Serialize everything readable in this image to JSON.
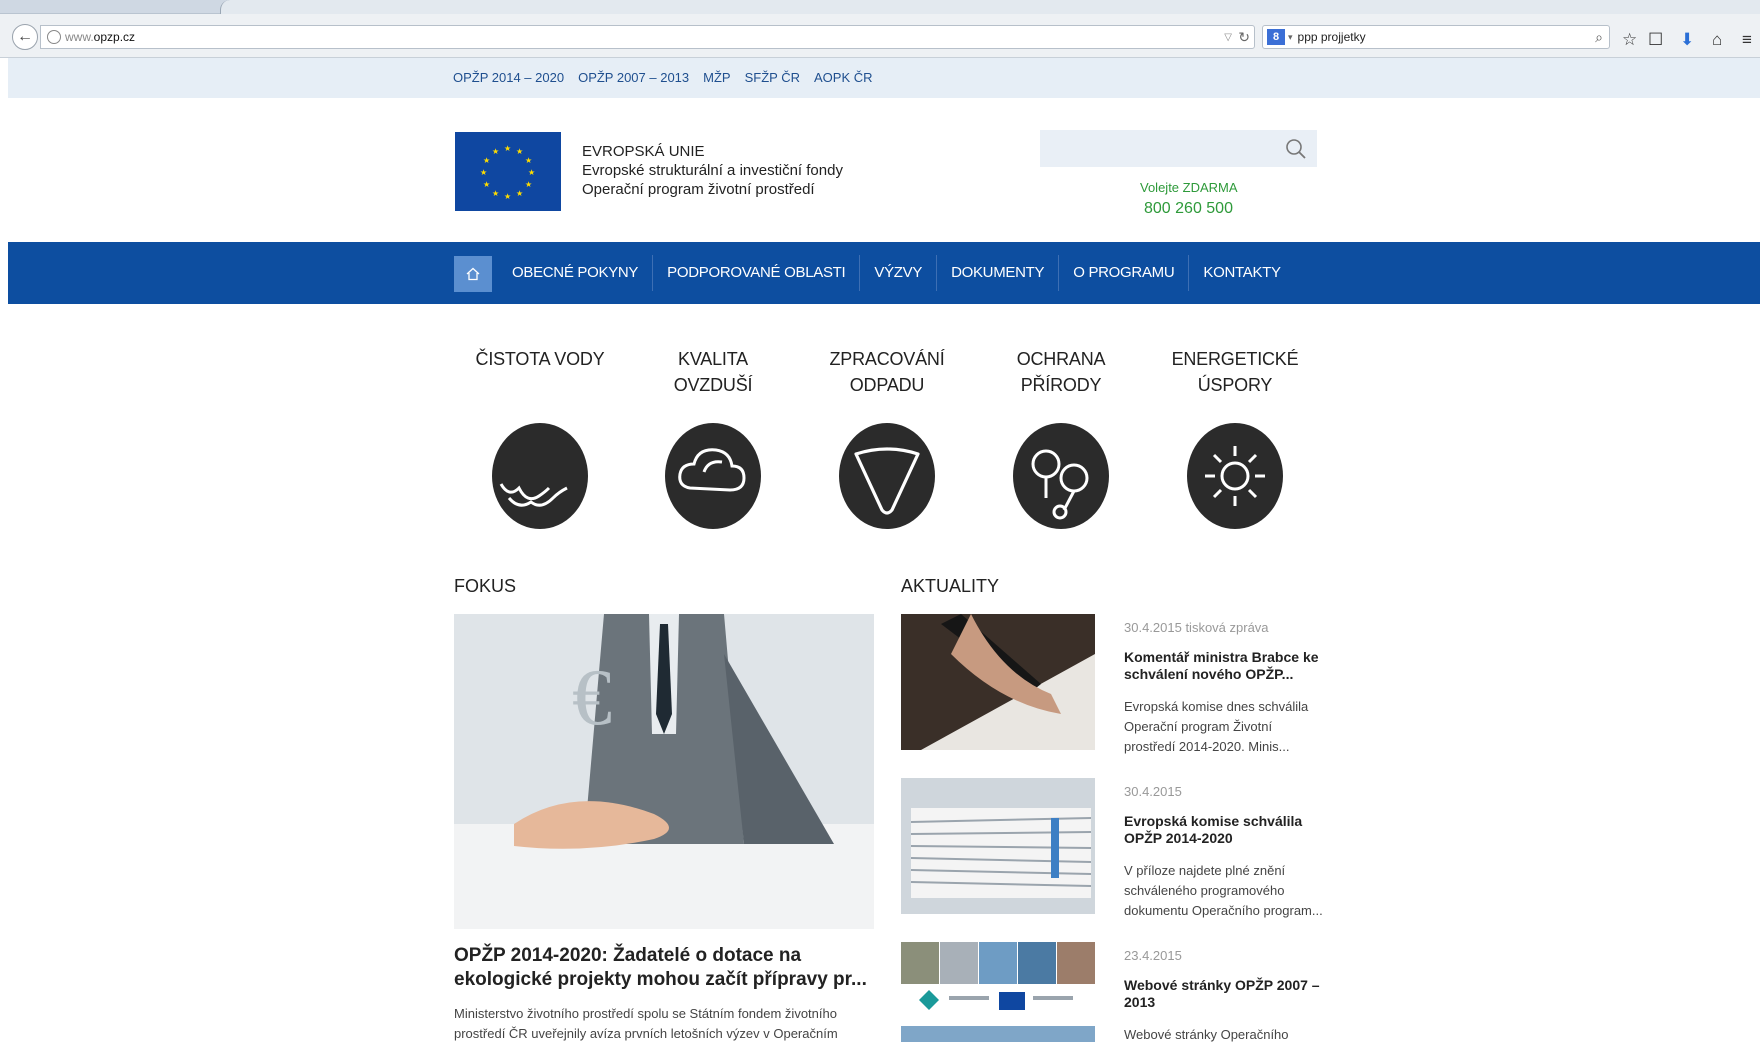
{
  "browser": {
    "url_prefix": "www.",
    "url_host": "opzp.cz",
    "search_query": "ppp projjetky"
  },
  "toplinks": [
    "OPŽP 2014 – 2020",
    "OPŽP 2007 – 2013",
    "MŽP",
    "SFŽP ČR",
    "AOPK ČR"
  ],
  "header": {
    "eu_line1": "EVROPSKÁ UNIE",
    "eu_line2": "Evropské strukturální a investiční fondy",
    "eu_line3": "Operační program životní prostředí",
    "search_placeholder": "",
    "hotline_label": "Volejte ZDARMA",
    "hotline_number": "800 260 500"
  },
  "nav": [
    "OBECNÉ POKYNY",
    "PODPOROVANÉ OBLASTI",
    "VÝZVY",
    "DOKUMENTY",
    "O PROGRAMU",
    "KONTAKTY"
  ],
  "categories": [
    {
      "line1": "ČISTOTA VODY",
      "line2": "",
      "icon": "water-icon"
    },
    {
      "line1": "KVALITA",
      "line2": "OVZDUŠÍ",
      "icon": "cloud-icon"
    },
    {
      "line1": "ZPRACOVÁNÍ",
      "line2": "ODPADU",
      "icon": "waste-icon"
    },
    {
      "line1": "OCHRANA",
      "line2": "PŘÍRODY",
      "icon": "trees-icon"
    },
    {
      "line1": "ENERGETICKÉ",
      "line2": "ÚSPORY",
      "icon": "sun-icon"
    }
  ],
  "focus": {
    "heading": "FOKUS",
    "title": "OPŽP 2014-2020: Žadatelé o dotace na ekologické projekty mohou začít přípravy pr...",
    "text": "Ministerstvo životního prostředí spolu se Státním fondem životního prostředí ČR uveřejnily avíza prvních letošních výzev v Operačním"
  },
  "news": {
    "heading": "AKTUALITY",
    "items": [
      {
        "date": "30.4.2015 tisková zpráva",
        "title": "Komentář ministra Brabce ke schválení nového OPŽP...",
        "text": "Evropská komise dnes schválila Operační program Životní prostředí 2014-2020. Minis..."
      },
      {
        "date": "30.4.2015",
        "title": "Evropská komise schválila OPŽP 2014-2020",
        "text": "V příloze najdete plné znění schváleného programového dokumentu Operačního program..."
      },
      {
        "date": "23.4.2015",
        "title": "Webové stránky OPŽP 2007 – 2013",
        "text": "Webové stránky Operačního"
      }
    ]
  }
}
